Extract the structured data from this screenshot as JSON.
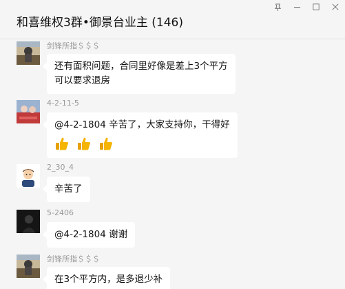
{
  "window": {
    "title": "和喜维权3群•御景台业主 (146)",
    "controls": [
      "pin-icon",
      "minimize-icon",
      "maximize-icon",
      "close-icon"
    ]
  },
  "messages": [
    {
      "sender": "剑锋所指＄＄＄",
      "lines": [
        "还有面积问题，合同里好像是差上3个平方",
        "可以要求退房"
      ],
      "avatar": "landscape-photo-avatar"
    },
    {
      "sender": "4-2-11-5",
      "lines": [
        "@4-2-1804 辛苦了，大家支持你，干得好"
      ],
      "emoji": [
        "thumbs-up-icon",
        "thumbs-up-icon",
        "thumbs-up-icon"
      ],
      "avatar": "red-scene-avatar"
    },
    {
      "sender": "2_30_4",
      "lines": [
        "辛苦了"
      ],
      "avatar": "cartoon-man-avatar"
    },
    {
      "sender": "5-2406",
      "lines": [
        "@4-2-1804 谢谢"
      ],
      "avatar": "dark-portrait-avatar"
    },
    {
      "sender": "剑锋所指＄＄＄",
      "lines": [
        "在3个平方内，是多退少补"
      ],
      "avatar": "landscape-photo-avatar"
    }
  ],
  "colors": {
    "background": "#f5f5f5",
    "bubble": "#ffffff",
    "sender_text": "#999999",
    "thumb": "#f5b400"
  }
}
